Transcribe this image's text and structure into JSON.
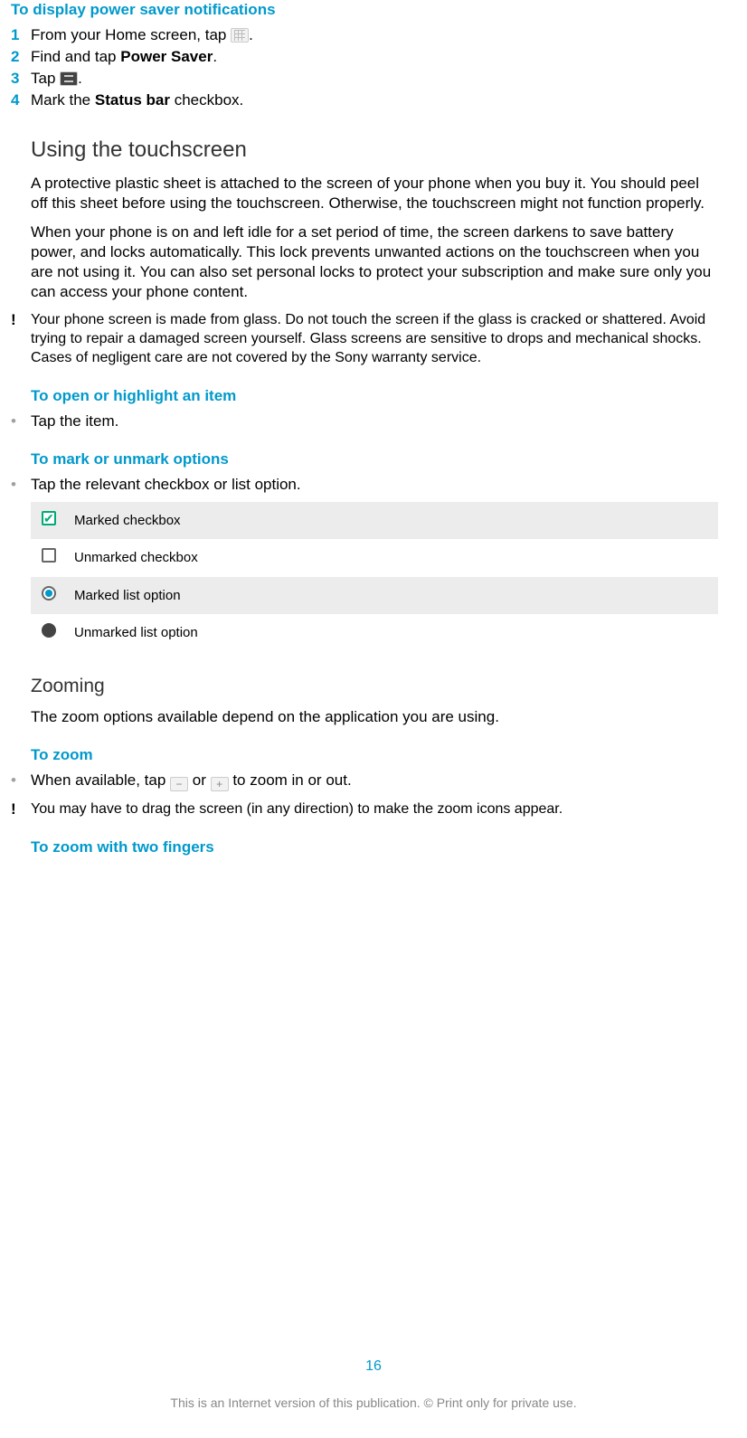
{
  "headings": {
    "h_power_saver": "To display power saver notifications",
    "h_touchscreen": "Using the touchscreen",
    "h_open_item": "To open or highlight an item",
    "h_mark_unmark": "To mark or unmark options",
    "h_zooming": "Zooming",
    "h_to_zoom": "To zoom",
    "h_zoom_two_fingers": "To zoom with two fingers"
  },
  "power_saver_steps": [
    {
      "n": "1",
      "pre": "From your Home screen, tap ",
      "post": "."
    },
    {
      "n": "2",
      "pre": "Find and tap ",
      "bold": "Power Saver",
      "post": "."
    },
    {
      "n": "3",
      "pre": "Tap ",
      "post": "."
    },
    {
      "n": "4",
      "pre": "Mark the ",
      "bold": "Status bar",
      "post": " checkbox."
    }
  ],
  "touchscreen_p1": "A protective plastic sheet is attached to the screen of your phone when you buy it. You should peel off this sheet before using the touchscreen. Otherwise, the touchscreen might not function properly.",
  "touchscreen_p2": "When your phone is on and left idle for a set period of time, the screen darkens to save battery power, and locks automatically. This lock prevents unwanted actions on the touchscreen when you are not using it. You can also set personal locks to protect your subscription and make sure only you can access your phone content.",
  "glass_warning": "Your phone screen is made from glass. Do not touch the screen if the glass is cracked or shattered. Avoid trying to repair a damaged screen yourself. Glass screens are sensitive to drops and mechanical shocks. Cases of negligent care are not covered by the Sony warranty service.",
  "open_item_bullet": "Tap the item.",
  "mark_unmark_bullet": "Tap the relevant checkbox or list option.",
  "options_table": [
    "Marked checkbox",
    "Unmarked checkbox",
    "Marked list option",
    "Unmarked list option"
  ],
  "zooming_p": "The zoom options available depend on the application you are using.",
  "to_zoom_bullet_pre": "When available, tap ",
  "to_zoom_bullet_mid": " or ",
  "to_zoom_bullet_post": " to zoom in or out.",
  "zoom_warning": "You may have to drag the screen (in any direction) to make the zoom icons appear.",
  "page_number": "16",
  "footer_text": "This is an Internet version of this publication. © Print only for private use."
}
